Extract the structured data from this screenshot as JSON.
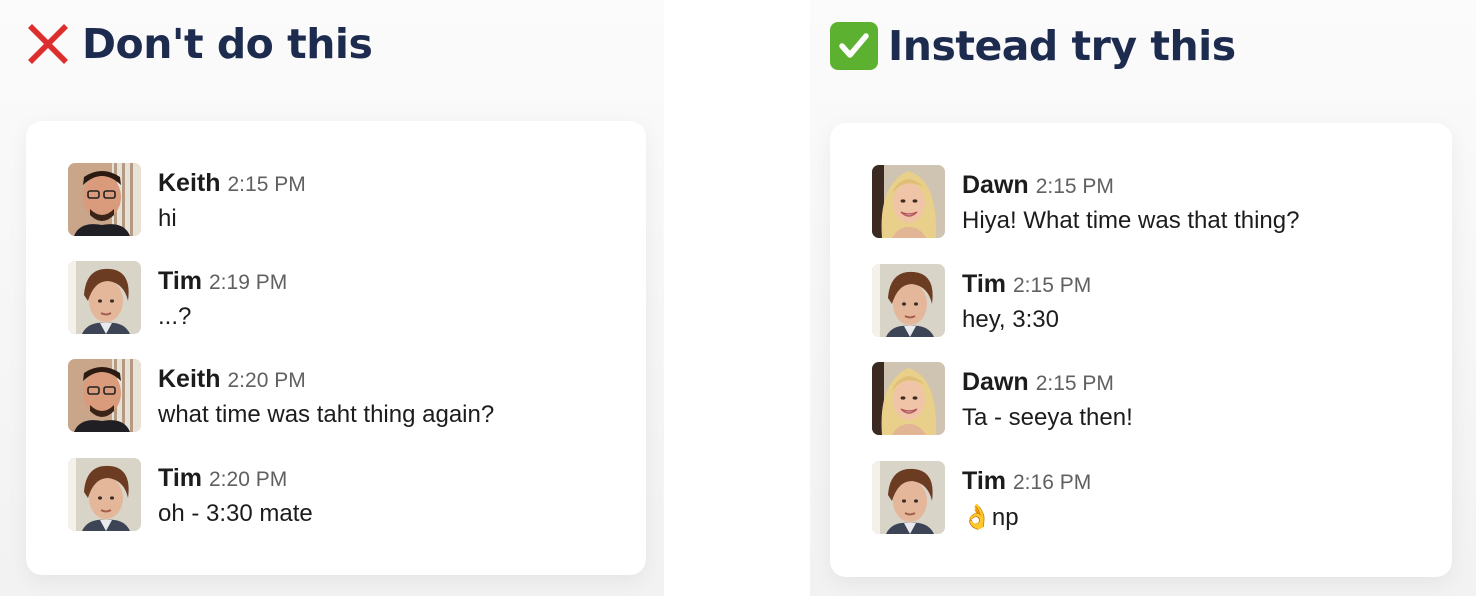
{
  "left": {
    "heading": "Don't do this",
    "mark_icon": "cross-mark-icon",
    "messages": [
      {
        "name": "Keith",
        "time": "2:15 PM",
        "text": "hi"
      },
      {
        "name": "Tim",
        "time": "2:19 PM",
        "text": "...?"
      },
      {
        "name": "Keith",
        "time": "2:20 PM",
        "text": "what time was taht thing again?"
      },
      {
        "name": "Tim",
        "time": "2:20 PM",
        "text": "oh - 3:30 mate"
      }
    ]
  },
  "right": {
    "heading": "Instead try this",
    "mark_icon": "check-mark-icon",
    "messages": [
      {
        "name": "Dawn",
        "time": "2:15 PM",
        "text": "Hiya! What time was that thing?"
      },
      {
        "name": "Tim",
        "time": "2:15 PM",
        "text": "hey, 3:30"
      },
      {
        "name": "Dawn",
        "time": "2:15 PM",
        "text": "Ta - seeya then!"
      },
      {
        "name": "Tim",
        "time": "2:16 PM",
        "emoji": "👌",
        "text": "np"
      }
    ]
  },
  "colors": {
    "heading": "#1d2b4f",
    "cross": "#dd2e2e",
    "check": "#5cb230",
    "name": "#1d1c1d",
    "time": "#616061"
  }
}
